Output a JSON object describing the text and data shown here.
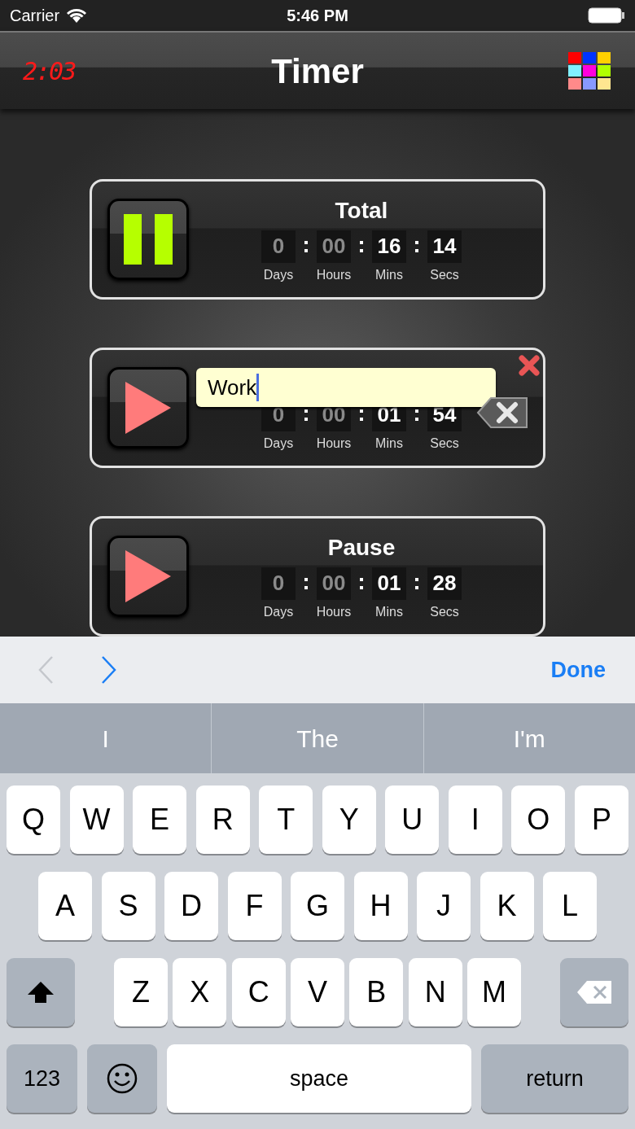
{
  "status_bar": {
    "carrier": "Carrier",
    "time": "5:46 PM"
  },
  "nav_bar": {
    "clock": "2:03",
    "title": "Timer"
  },
  "timers": [
    {
      "kind": "running",
      "editing": false,
      "title": "Total",
      "units": [
        {
          "value": "0",
          "label": "Days",
          "dimmed": true
        },
        {
          "value": "00",
          "label": "Hours",
          "dimmed": true
        },
        {
          "value": "16",
          "label": "Mins",
          "dimmed": false
        },
        {
          "value": "14",
          "label": "Secs",
          "dimmed": false
        }
      ]
    },
    {
      "kind": "stopped",
      "editing": true,
      "name_field": "Work",
      "units": [
        {
          "value": "0",
          "label": "Days",
          "dimmed": true
        },
        {
          "value": "00",
          "label": "Hours",
          "dimmed": true
        },
        {
          "value": "01",
          "label": "Mins",
          "dimmed": false
        },
        {
          "value": "54",
          "label": "Secs",
          "dimmed": false
        }
      ]
    },
    {
      "kind": "stopped",
      "editing": false,
      "title": "Pause",
      "units": [
        {
          "value": "0",
          "label": "Days",
          "dimmed": true
        },
        {
          "value": "00",
          "label": "Hours",
          "dimmed": true
        },
        {
          "value": "01",
          "label": "Mins",
          "dimmed": false
        },
        {
          "value": "28",
          "label": "Secs",
          "dimmed": false
        }
      ]
    }
  ],
  "keyboard_toolbar": {
    "arrows": [
      {
        "kind": "prev",
        "disabled": true
      },
      {
        "kind": "next",
        "disabled": false
      }
    ],
    "done": "Done"
  },
  "suggestions": [
    "I",
    "The",
    "I'm"
  ],
  "key_rows": [
    [
      "Q",
      "W",
      "E",
      "R",
      "T",
      "Y",
      "U",
      "I",
      "O",
      "P"
    ],
    [
      "A",
      "S",
      "D",
      "F",
      "G",
      "H",
      "J",
      "K",
      "L"
    ],
    [
      "Z",
      "X",
      "C",
      "V",
      "B",
      "N",
      "M"
    ]
  ],
  "bottom_row": {
    "numbers": "123",
    "space": "space",
    "return": "return"
  }
}
